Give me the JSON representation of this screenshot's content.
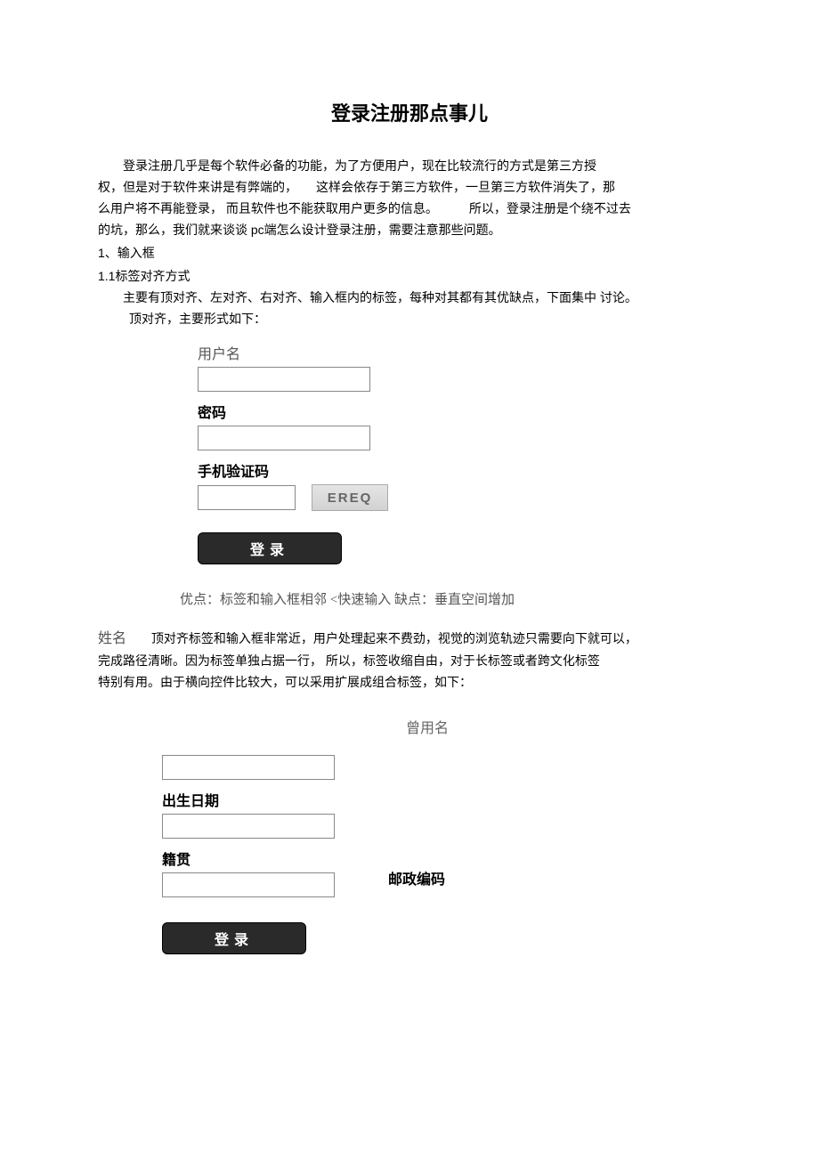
{
  "title": "登录注册那点事儿",
  "intro_line1": "登录注册几乎是每个软件必备的功能，为了方便用户，现在比较流行的方式是第三方授",
  "intro_line2": "权，但是对于软件来讲是有弊端的，　　这样会依存于第三方软件，一旦第三方软件消失了，那",
  "intro_line3": "么用户将不再能登录， 而且软件也不能获取用户更多的信息。　　　所以，登录注册是个绕不过去",
  "intro_line4": "的坑，那么，我们就来谈谈 pc端怎么设计登录注册，需要注意那些问题。",
  "sec1": "1、输入框",
  "sec11": "1.1标签对齐方式",
  "sec11_line1": "主要有顶对齐、左对齐、右对齐、输入框内的标签，每种对其都有其优缺点，下面集中 讨论。",
  "sec11_line2": "顶对齐，主要形式如下：",
  "form1": {
    "username_label": "用户名",
    "password_label": "密码",
    "phone_code_label": "手机验证码",
    "captcha_text": "EREQ",
    "login_btn": "登录"
  },
  "caption1": "优点：标签和输入框相邻  <快速输入  缺点：垂直空间增加",
  "para2_lead": "姓名",
  "para2_line1": "顶对齐标签和输入框非常近，用户处理起来不费劲，视觉的浏览轨迹只需要向下就可以，",
  "para2_line2": "完成路径清晰。因为标签单独占据一行， 所以，标签收缩自由，对于长标签或者跨文化标签",
  "para2_line3": "特别有用。由于横向控件比较大，可以采用扩展成组合标签，如下：",
  "form2": {
    "former_name_label": "曾用名",
    "birth_label": "出生日期",
    "native_place_label": "籍贯",
    "postal_label": "邮政编码",
    "login_btn": "登录"
  }
}
